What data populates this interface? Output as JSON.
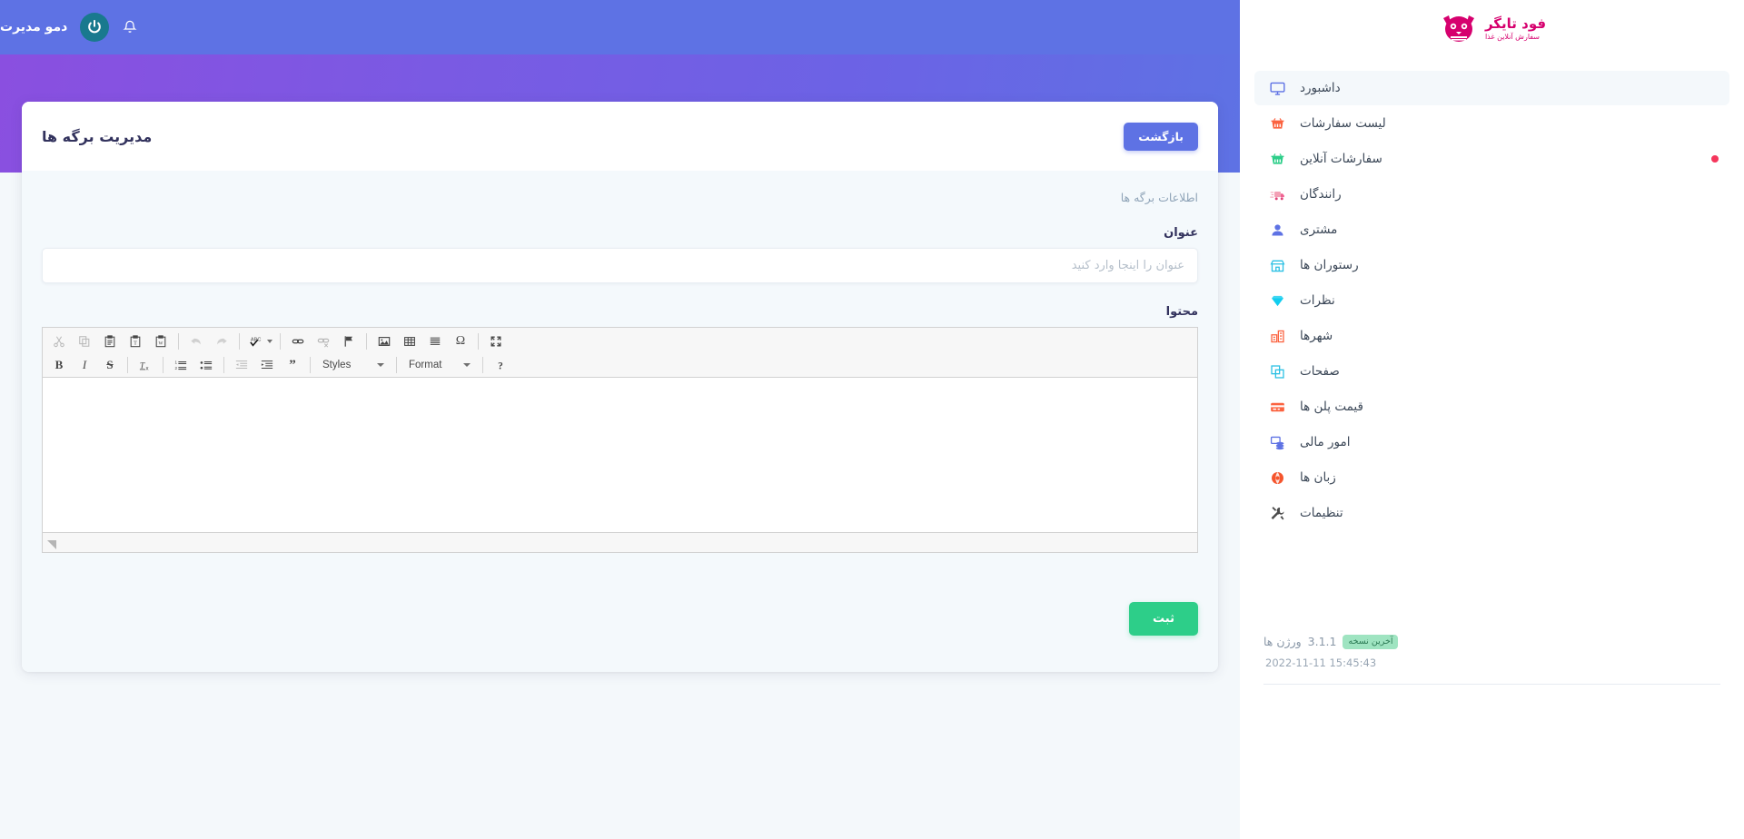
{
  "brand": {
    "name": "فود تایگر",
    "tagline": "سفارش آنلاین غذا",
    "logo_icon": "tiger-head-icon"
  },
  "navbar": {
    "title": "دمو مدیرت",
    "power_icon": "power-icon",
    "bell_icon": "bell-icon"
  },
  "sidebar": {
    "items": [
      {
        "label": "داشبورد",
        "icon": "monitor-icon",
        "active": true,
        "dot": false
      },
      {
        "label": "لیست سفارشات",
        "icon": "basket-icon",
        "active": false,
        "dot": false
      },
      {
        "label": "سفارشات آنلاین",
        "icon": "basket-green-icon",
        "active": false,
        "dot": true
      },
      {
        "label": "رانندگان",
        "icon": "truck-icon",
        "active": false,
        "dot": false
      },
      {
        "label": "مشتری",
        "icon": "user-icon",
        "active": false,
        "dot": false
      },
      {
        "label": "رستوران ها",
        "icon": "shop-icon",
        "active": false,
        "dot": false
      },
      {
        "label": "نظرات",
        "icon": "diamond-icon",
        "active": false,
        "dot": false
      },
      {
        "label": "شهرها",
        "icon": "building-icon",
        "active": false,
        "dot": false
      },
      {
        "label": "صفحات",
        "icon": "copy-icon",
        "active": false,
        "dot": false
      },
      {
        "label": "قیمت پلن ها",
        "icon": "card-icon",
        "active": false,
        "dot": false
      },
      {
        "label": "امور مالی",
        "icon": "coins-icon",
        "active": false,
        "dot": false
      },
      {
        "label": "زبان ها",
        "icon": "globe-icon",
        "active": false,
        "dot": false
      },
      {
        "label": "تنظیمات",
        "icon": "tools-icon",
        "active": false,
        "dot": false
      }
    ],
    "version": {
      "label": "ورژن ها",
      "number": "3.1.1",
      "badge": "آخرین نسخه",
      "date": "2022-11-11 15:45:43"
    }
  },
  "page": {
    "title": "مدیریت برگه ها",
    "back_button": "بازگشت",
    "legend": "اطلاعات برگه ها",
    "title_field": {
      "label": "عنوان",
      "placeholder": "عنوان را اینجا وارد کنید",
      "value": ""
    },
    "content_field": {
      "label": "محتوا",
      "value": ""
    },
    "submit_button": "ثبت"
  },
  "editor": {
    "toolbar_row1": [
      {
        "name": "cut-icon",
        "glyph": "✂",
        "disabled": true
      },
      {
        "name": "copy-icon",
        "glyph": "⧉",
        "disabled": true
      },
      {
        "name": "paste-icon",
        "glyph": "📋",
        "disabled": false
      },
      {
        "name": "paste-as-text-icon",
        "glyph": "T",
        "disabled": false
      },
      {
        "name": "paste-from-word-icon",
        "glyph": "W",
        "disabled": false
      },
      {
        "sep": true
      },
      {
        "name": "undo-icon",
        "glyph": "↩",
        "disabled": true
      },
      {
        "name": "redo-icon",
        "glyph": "↪",
        "disabled": true
      },
      {
        "sep": true
      },
      {
        "name": "spellcheck-icon",
        "glyph": "ABC",
        "disabled": false
      },
      {
        "sep": true
      },
      {
        "name": "link-icon",
        "glyph": "🔗",
        "disabled": false
      },
      {
        "name": "unlink-icon",
        "glyph": "🔗",
        "disabled": true
      },
      {
        "name": "anchor-flag-icon",
        "glyph": "⚑",
        "disabled": false
      },
      {
        "sep": true
      },
      {
        "name": "image-icon",
        "glyph": "🖼",
        "disabled": false
      },
      {
        "name": "table-icon",
        "glyph": "▦",
        "disabled": false
      },
      {
        "name": "horizontal-rule-icon",
        "glyph": "≡",
        "disabled": false
      },
      {
        "name": "special-char-icon",
        "glyph": "Ω",
        "disabled": false
      },
      {
        "sep": true
      },
      {
        "name": "maximize-icon",
        "glyph": "⤢",
        "disabled": false
      }
    ],
    "toolbar_row2": [
      {
        "name": "bold-icon",
        "glyph": "B",
        "disabled": false
      },
      {
        "name": "italic-icon",
        "glyph": "I",
        "disabled": false
      },
      {
        "name": "strikethrough-icon",
        "glyph": "S",
        "disabled": false
      },
      {
        "sep": true
      },
      {
        "name": "remove-format-icon",
        "glyph": "Tx",
        "disabled": false
      },
      {
        "sep": true
      },
      {
        "name": "numbered-list-icon",
        "glyph": "1≡",
        "disabled": false
      },
      {
        "name": "bulleted-list-icon",
        "glyph": "•≡",
        "disabled": false
      },
      {
        "sep": true
      },
      {
        "name": "outdent-icon",
        "glyph": "⇤",
        "disabled": true
      },
      {
        "name": "indent-icon",
        "glyph": "⇥",
        "disabled": false
      },
      {
        "name": "blockquote-icon",
        "glyph": "❞",
        "disabled": false
      },
      {
        "sep": true
      }
    ],
    "combo_styles": "Styles",
    "combo_format": "Format",
    "help_icon": "help-icon"
  },
  "colors": {
    "navbar": "#5e72e4",
    "banner_start": "#8a4fe0",
    "banner_end": "#5e72e4",
    "brand": "#d6006e",
    "submit": "#2dce89",
    "back": "#5e72e4",
    "badge": "#9fe4c1",
    "dot": "#f5365c"
  }
}
